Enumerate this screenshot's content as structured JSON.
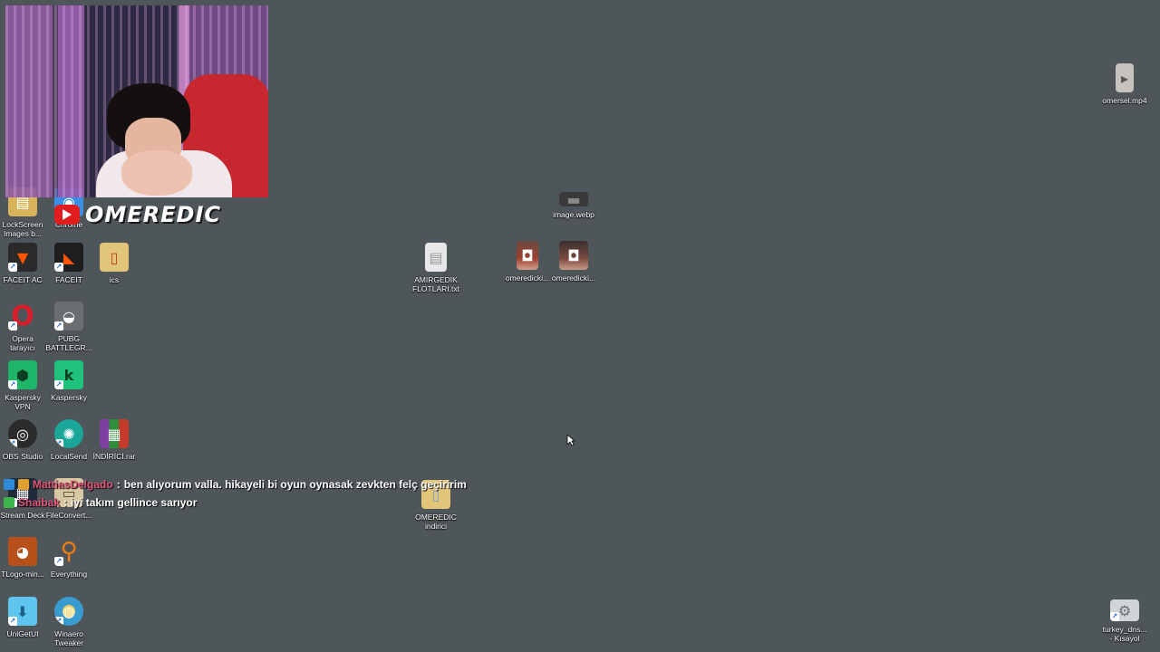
{
  "brand": {
    "name": "OMEREDIC"
  },
  "chat": [
    {
      "user": "MattiasDelgado",
      "separator": ":",
      "message": "ben alıyorum valla. hikayeli bi oyun oynasak zevkten felç geçiririm"
    },
    {
      "user": "Shaibak",
      "separator": ":",
      "message": "iyi takım gellince sarıyor"
    }
  ],
  "icons": [
    {
      "label": "LockScreen\nImages b...",
      "glyph": "▤",
      "color": "#d8b35a",
      "icon": "folder-icon"
    },
    {
      "label": "Chrome",
      "glyph": "◉",
      "color": "#3b8ee6",
      "icon": "chrome-icon"
    },
    {
      "label": "FACEIT AC",
      "glyph": "▼",
      "color": "#ff5500",
      "icon": "faceit-ac-icon"
    },
    {
      "label": "FACEIT",
      "glyph": "◣",
      "color": "#1e1e1e",
      "icon": "faceit-icon"
    },
    {
      "label": "ics",
      "glyph": "▯",
      "color": "#e3c57a",
      "icon": "folder-icon"
    },
    {
      "label": "Opera\ntarayıcı",
      "glyph": "O",
      "color": "#d81f2b",
      "icon": "opera-icon"
    },
    {
      "label": "PUBG\nBATTLEGR...",
      "glyph": "◒",
      "color": "#6b6e70",
      "icon": "pubg-icon"
    },
    {
      "label": "Kaspersky\nVPN",
      "glyph": "⬢",
      "color": "#1fb568",
      "icon": "kaspersky-vpn-icon"
    },
    {
      "label": "Kaspersky",
      "glyph": "k",
      "color": "#1fc27a",
      "icon": "kaspersky-icon"
    },
    {
      "label": "OBS Studio",
      "glyph": "◎",
      "color": "#2b2b2b",
      "icon": "obs-icon"
    },
    {
      "label": "LocalSend",
      "glyph": "✺",
      "color": "#1aa79a",
      "icon": "localsend-icon"
    },
    {
      "label": "İNDİRİCİ.rar",
      "glyph": "▦",
      "color": "#7d3fa0",
      "icon": "winrar-icon"
    },
    {
      "label": "Stream Deck",
      "glyph": "▦",
      "color": "#202b3a",
      "icon": "stream-deck-icon"
    },
    {
      "label": "FileConvert...",
      "glyph": "▭",
      "color": "#d7c7a3",
      "icon": "file-converter-icon"
    },
    {
      "label": "TLogo-min...",
      "glyph": "◕",
      "color": "#b8501c",
      "icon": "image-icon"
    },
    {
      "label": "Everything",
      "glyph": "⚲",
      "color": "#f07d12",
      "icon": "everything-icon"
    },
    {
      "label": "UniGetUI",
      "glyph": "⬇",
      "color": "#2fa0d8",
      "icon": "unigetui-icon"
    },
    {
      "label": "Winaero\nTweaker",
      "glyph": "◍",
      "color": "#3a9bd0",
      "icon": "winaero-icon"
    },
    {
      "label": "AMIRGEDIK\nFLOTLARI.txt",
      "glyph": "▤",
      "color": "#e8e8e8",
      "icon": "text-file-icon"
    },
    {
      "label": "omeredicki...",
      "glyph": "◘",
      "color": "#a04030",
      "icon": "image-icon"
    },
    {
      "label": "omeredicki...",
      "glyph": "◘",
      "color": "#7a4a40",
      "icon": "image-icon"
    },
    {
      "label": "image.webp",
      "glyph": "▬",
      "color": "#3a3a3a",
      "icon": "image-icon"
    },
    {
      "label": "OMEREDIC\nindirici",
      "glyph": "▯",
      "color": "#e3c57a",
      "icon": "folder-icon"
    },
    {
      "label": "omersel.mp4",
      "glyph": "▸",
      "color": "#c7c2bd",
      "icon": "video-icon"
    },
    {
      "label": "turkey_dns...\n- Kısayol",
      "glyph": "⚙",
      "color": "#cfd4d6",
      "icon": "settings-shortcut-icon"
    }
  ]
}
